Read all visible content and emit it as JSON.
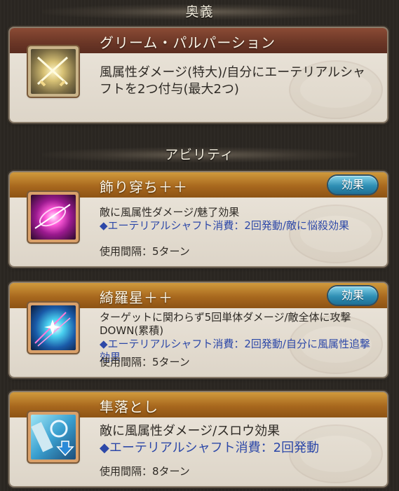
{
  "ougi": {
    "section_title": "奥義",
    "name": "グリーム・パルパーション",
    "description": "風属性ダメージ(特大)/自分にエーテリアルシャフトを2つ付与(最大2つ)"
  },
  "abilities": {
    "section_title": "アビリティ",
    "items": [
      {
        "name": "飾り穿ち＋＋",
        "effect_button": "効果",
        "description": "敵に風属性ダメージ/魅了効果",
        "extra": "◆エーテリアルシャフト消費：2回発動/敵に悩殺効果",
        "interval": "使用間隔：5ターン"
      },
      {
        "name": "綺羅星＋＋",
        "effect_button": "効果",
        "description": "ターゲットに関わらず5回単体ダメージ/敵全体に攻撃DOWN(累積)",
        "extra": "◆エーテリアルシャフト消費：2回発動/自分に風属性追撃効果",
        "interval": "使用間隔：5ターン"
      },
      {
        "name": "隼落とし",
        "description": "敵に風属性ダメージ/スロウ効果",
        "extra": "◆エーテリアルシャフト消費：2回発動",
        "interval": "使用間隔：8ターン"
      }
    ]
  },
  "colors": {
    "ougi_title_bar": "#6a3626",
    "ability_title_bar": "#a8681e",
    "highlight_text": "#2d48a8",
    "effect_button": "#2f8fb4"
  },
  "icons": [
    "crossed-swords-icon",
    "pink-slash-burst-icon",
    "blue-starburst-icon",
    "falcon-drop-icon"
  ]
}
